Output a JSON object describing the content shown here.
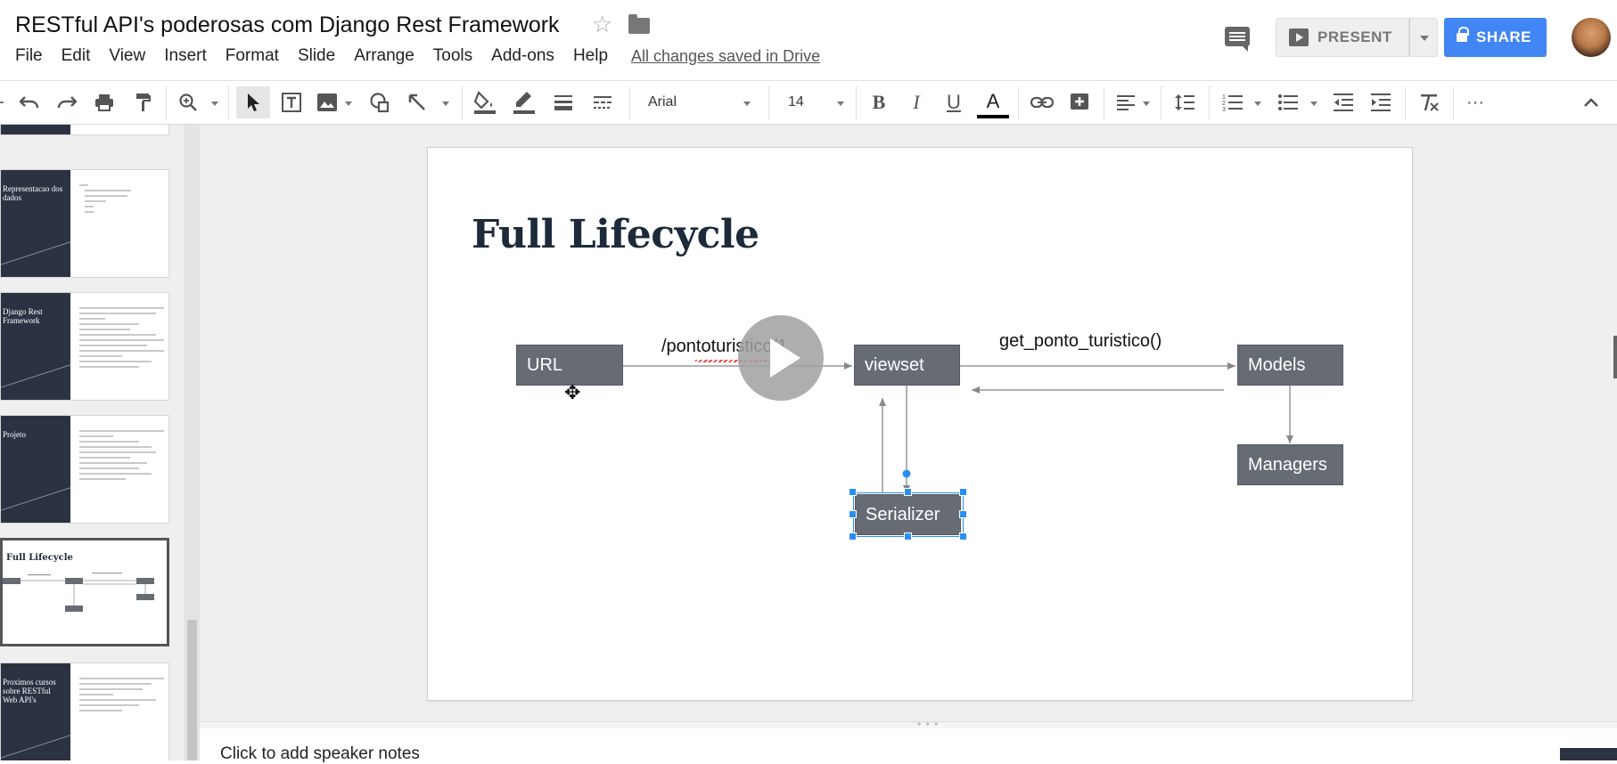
{
  "header": {
    "doc_title": "RESTful API's poderosas com Django Rest Framework",
    "menu": [
      "File",
      "Edit",
      "View",
      "Insert",
      "Format",
      "Slide",
      "Arrange",
      "Tools",
      "Add-ons",
      "Help"
    ],
    "save_status": "All changes saved in Drive",
    "present_label": "PRESENT",
    "share_label": "SHARE",
    "icons": [
      "star-icon",
      "folder-icon",
      "comments-icon",
      "avatar"
    ]
  },
  "toolbar": {
    "font_name": "Arial",
    "font_size": "14",
    "bold": "B",
    "italic": "I",
    "underline": "U",
    "text_color": "A",
    "more": "···"
  },
  "filmstrip": {
    "slides": [
      {
        "title": ""
      },
      {
        "title": "Representacao dos dados"
      },
      {
        "title": "Django Rest Framework"
      },
      {
        "title": "Projeto"
      },
      {
        "title": "Full Lifecycle"
      },
      {
        "title": "Proximos cursos sobre RESTful Web API's"
      }
    ],
    "selected_index": 4
  },
  "slide": {
    "title": "Full Lifecycle",
    "nodes": {
      "url": "URL",
      "viewset": "viewset",
      "models": "Models",
      "managers": "Managers",
      "serializer": "Serializer"
    },
    "edge_labels": {
      "url_to_viewset": "/pontoturistico/1",
      "viewset_to_models": "get_ponto_turistico()"
    }
  },
  "notes": {
    "placeholder": "Click to add speaker notes"
  },
  "colors": {
    "accent": "#4285f4",
    "node_fill": "#676b74",
    "selection": "#2a8ff2",
    "slide_title": "#1c2a3a",
    "thumb_dark": "#2b3343"
  }
}
